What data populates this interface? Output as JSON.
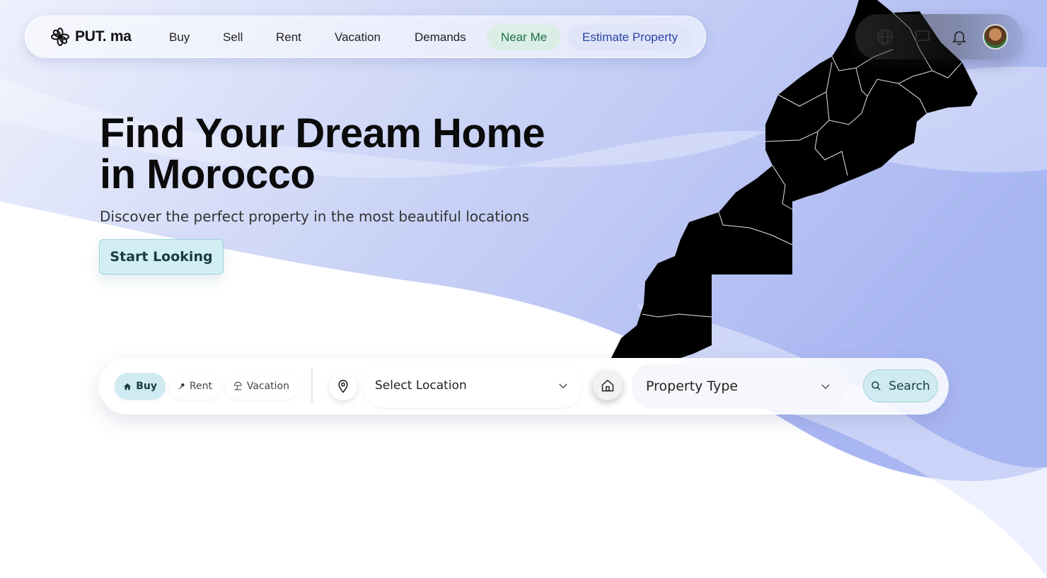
{
  "brand": {
    "name": "PUT. ma"
  },
  "nav": {
    "links": [
      "Buy",
      "Sell",
      "Rent",
      "Vacation",
      "Demands"
    ],
    "near_me": "Near Me",
    "estimate": "Estimate Property"
  },
  "header_icons": [
    "globe-icon",
    "chat-icon",
    "bell-icon",
    "avatar"
  ],
  "hero": {
    "title_line1": "Find Your Dream Home",
    "title_line2": "in Morocco",
    "subtitle": "Discover the perfect property in the most beautiful locations",
    "cta": "Start Looking"
  },
  "search": {
    "tabs": [
      "Buy",
      "Rent",
      "Vacation"
    ],
    "active_tab": "Buy",
    "location_placeholder": "Select Location",
    "property_type_placeholder": "Property Type",
    "search_label": "Search"
  },
  "colors": {
    "accent_teal": "#cfeaf0",
    "near_me_bg": "#dbeee6",
    "estimate_bg": "#dfe4f6",
    "background_wave": "#c9d2f6"
  }
}
